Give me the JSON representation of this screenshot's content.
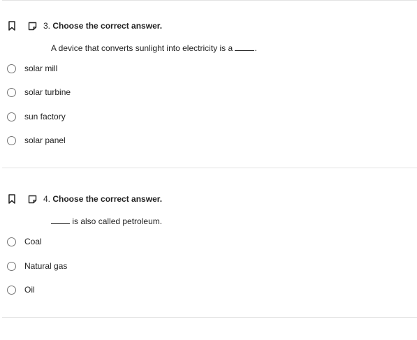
{
  "questions": [
    {
      "number": "3.",
      "title": "Choose the correct answer.",
      "stem_before": "A device that converts sunlight into electricity is a",
      "stem_after": ".",
      "options": [
        "solar mill",
        "solar turbine",
        "sun factory",
        "solar panel"
      ]
    },
    {
      "number": "4.",
      "title": "Choose the correct answer.",
      "stem_before": "",
      "stem_after": "is also called petroleum.",
      "options": [
        "Coal",
        "Natural gas",
        "Oil"
      ]
    }
  ],
  "icons": {
    "bookmark": "bookmark-icon",
    "note": "note-icon"
  },
  "colors": {
    "text": "#222222",
    "radio_border": "#757575",
    "divider": "#e2e2e2"
  }
}
